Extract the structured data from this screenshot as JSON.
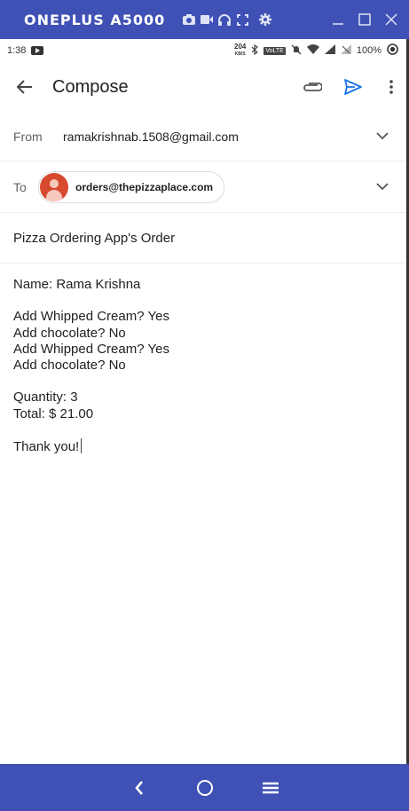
{
  "window": {
    "device_name": "ONEPLUS A5000",
    "accent": "#3f51b5"
  },
  "statusbar": {
    "time": "1:38",
    "speed_value": "204",
    "speed_unit": "KB/S",
    "network_badge": "VoLTE",
    "battery": "100%"
  },
  "appbar": {
    "title": "Compose"
  },
  "from": {
    "label": "From",
    "value": "ramakrishnab.1508@gmail.com"
  },
  "to": {
    "label": "To",
    "recipient": "orders@thepizzaplace.com"
  },
  "subject": "Pizza Ordering App's Order",
  "body": {
    "lines_1": [
      "Name: Rama Krishna"
    ],
    "lines_2": [
      "Add Whipped Cream? Yes",
      "Add chocolate? No",
      "Add Whipped Cream? Yes",
      "Add chocolate? No"
    ],
    "lines_3": [
      "Quantity: 3",
      "Total: $ 21.00"
    ],
    "lines_4": [
      "Thank you!"
    ]
  }
}
